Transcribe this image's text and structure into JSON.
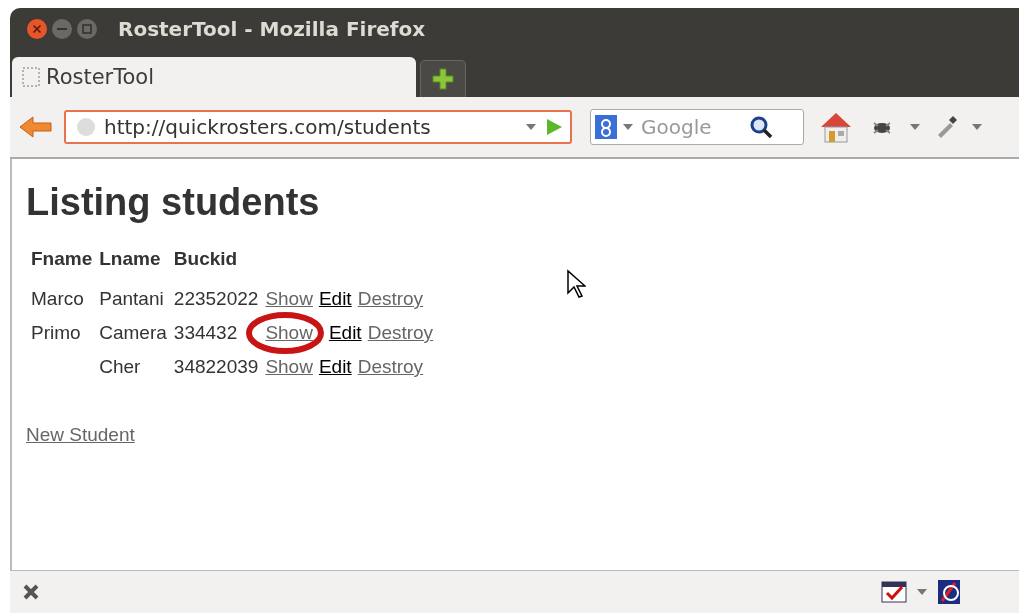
{
  "window": {
    "title": "RosterTool - Mozilla Firefox"
  },
  "tabs": [
    {
      "label": "RosterTool",
      "selected": true
    }
  ],
  "toolbar": {
    "url": "http://quickrosters.com/students",
    "search_placeholder": "Google"
  },
  "page": {
    "heading": "Listing students",
    "table": {
      "columns": [
        "Fname",
        "Lname",
        "Buckid"
      ],
      "rows": [
        {
          "cells": [
            "Marco",
            "Pantani",
            "22352022"
          ],
          "links": [
            {
              "label": "Show",
              "visited": true,
              "circled": false
            },
            {
              "label": "Edit",
              "visited": false,
              "circled": false
            },
            {
              "label": "Destroy",
              "visited": true,
              "circled": false
            }
          ]
        },
        {
          "cells": [
            "Primo",
            "Camera",
            "334432"
          ],
          "links": [
            {
              "label": "Show",
              "visited": true,
              "circled": true
            },
            {
              "label": "Edit",
              "visited": false,
              "circled": false
            },
            {
              "label": "Destroy",
              "visited": true,
              "circled": false
            }
          ]
        },
        {
          "cells": [
            "",
            "Cher",
            "34822039"
          ],
          "links": [
            {
              "label": "Show",
              "visited": true,
              "circled": false
            },
            {
              "label": "Edit",
              "visited": false,
              "circled": false
            },
            {
              "label": "Destroy",
              "visited": true,
              "circled": false
            }
          ]
        }
      ]
    },
    "new_link": {
      "label": "New Student",
      "visited": true
    }
  }
}
